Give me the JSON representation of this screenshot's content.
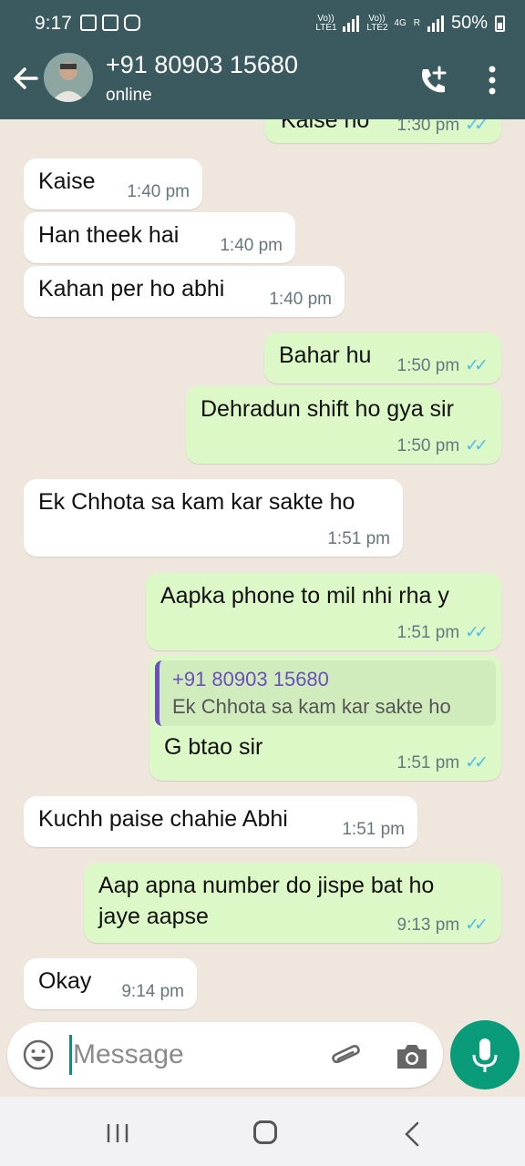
{
  "status_bar": {
    "time": "9:17",
    "battery": "50%",
    "net_labels": [
      "Vo)) LTE1",
      "Vo)) LTE2",
      "4G",
      "R"
    ]
  },
  "header": {
    "contact_name": "+91 80903 15680",
    "status": "online"
  },
  "colors": {
    "header_bg": "#3a5a5f",
    "chat_bg": "#efe7de",
    "incoming_bubble": "#ffffff",
    "outgoing_bubble": "#dcf8c6",
    "read_ticks": "#53bdeb",
    "quote_accent": "#6b4fbb",
    "mic_button": "#0a9b7a"
  },
  "messages": [
    {
      "dir": "out",
      "text": "Kaise ho",
      "time": "1:30 pm",
      "read": true
    },
    {
      "dir": "in",
      "text": "Kaise",
      "time": "1:40 pm"
    },
    {
      "dir": "in",
      "text": "Han theek hai",
      "time": "1:40 pm"
    },
    {
      "dir": "in",
      "text": "Kahan per ho abhi",
      "time": "1:40 pm"
    },
    {
      "dir": "out",
      "text": "Bahar hu",
      "time": "1:50 pm",
      "read": true
    },
    {
      "dir": "out",
      "text": "Dehradun shift ho gya sir",
      "time": "1:50 pm",
      "read": true
    },
    {
      "dir": "in",
      "text": "Ek Chhota sa kam kar sakte ho",
      "time": "1:51 pm"
    },
    {
      "dir": "out",
      "text": "Aapka phone to mil nhi rha y",
      "time": "1:51 pm",
      "read": true
    },
    {
      "dir": "out",
      "text": "G btao sir",
      "time": "1:51 pm",
      "read": true,
      "quote": {
        "author": "+91 80903 15680",
        "text": "Ek Chhota sa kam kar sakte ho"
      }
    },
    {
      "dir": "in",
      "text": "Kuchh paise chahie Abhi",
      "time": "1:51 pm"
    },
    {
      "dir": "out",
      "text_line1": "Aap apna number do jispe bat ho",
      "text_line2": "jaye aapse",
      "time": "9:13 pm",
      "read": true
    },
    {
      "dir": "in",
      "text": "Okay",
      "time": "9:14 pm"
    }
  ],
  "composer": {
    "placeholder": "Message"
  },
  "icons": {
    "back": "arrow-left-icon",
    "call": "add-call-icon",
    "menu": "vertical-dots-icon",
    "emoji": "emoji-icon",
    "attach": "paperclip-icon",
    "camera": "camera-icon",
    "mic": "mic-icon"
  }
}
